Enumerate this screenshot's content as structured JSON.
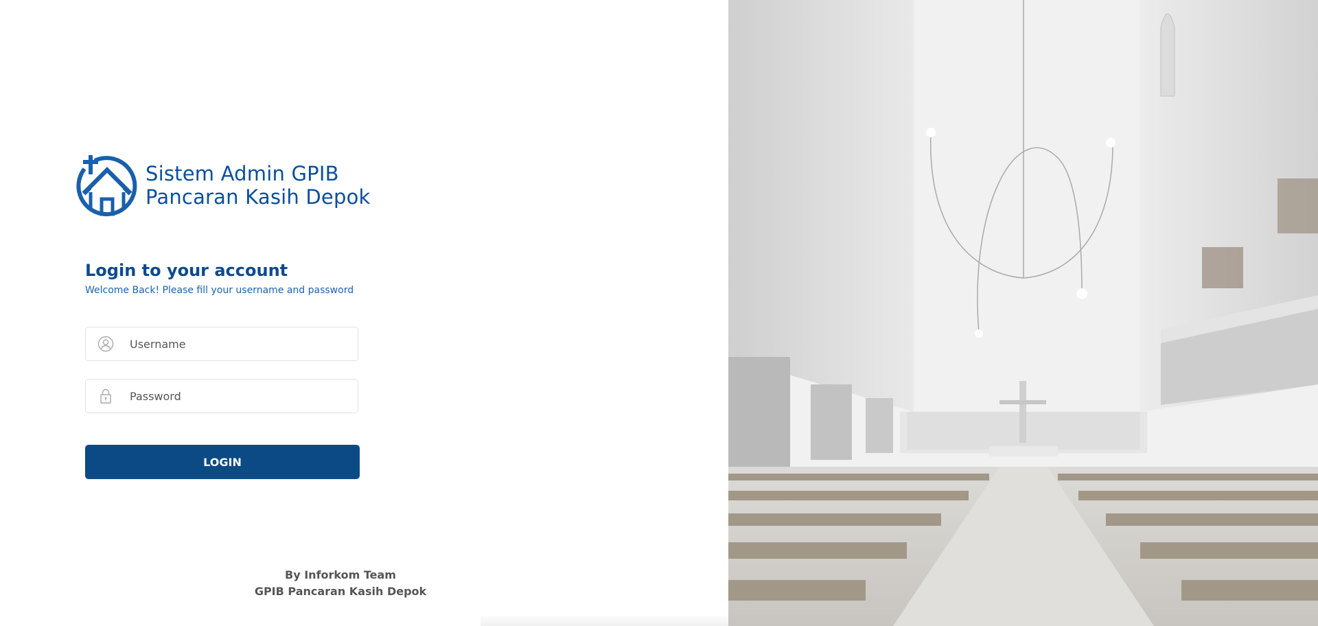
{
  "brand": {
    "line1": "Sistem Admin GPIB",
    "line2": "Pancaran Kasih Depok",
    "logo_icon": "church-house-cross-logo-icon",
    "color": "#0b4f9c"
  },
  "login": {
    "heading": "Login to your account",
    "subheading": "Welcome Back! Please fill your username and password",
    "username": {
      "placeholder": "Username",
      "value": "",
      "icon": "user-circle-icon"
    },
    "password": {
      "placeholder": "Password",
      "value": "",
      "icon": "lock-icon"
    },
    "button_label": "LOGIN",
    "button_color": "#0b4a85"
  },
  "footer": {
    "line1": "By Inforkom Team",
    "line2": "GPIB Pancaran Kasih Depok"
  },
  "hero_image": {
    "subject": "church-interior-photo"
  }
}
